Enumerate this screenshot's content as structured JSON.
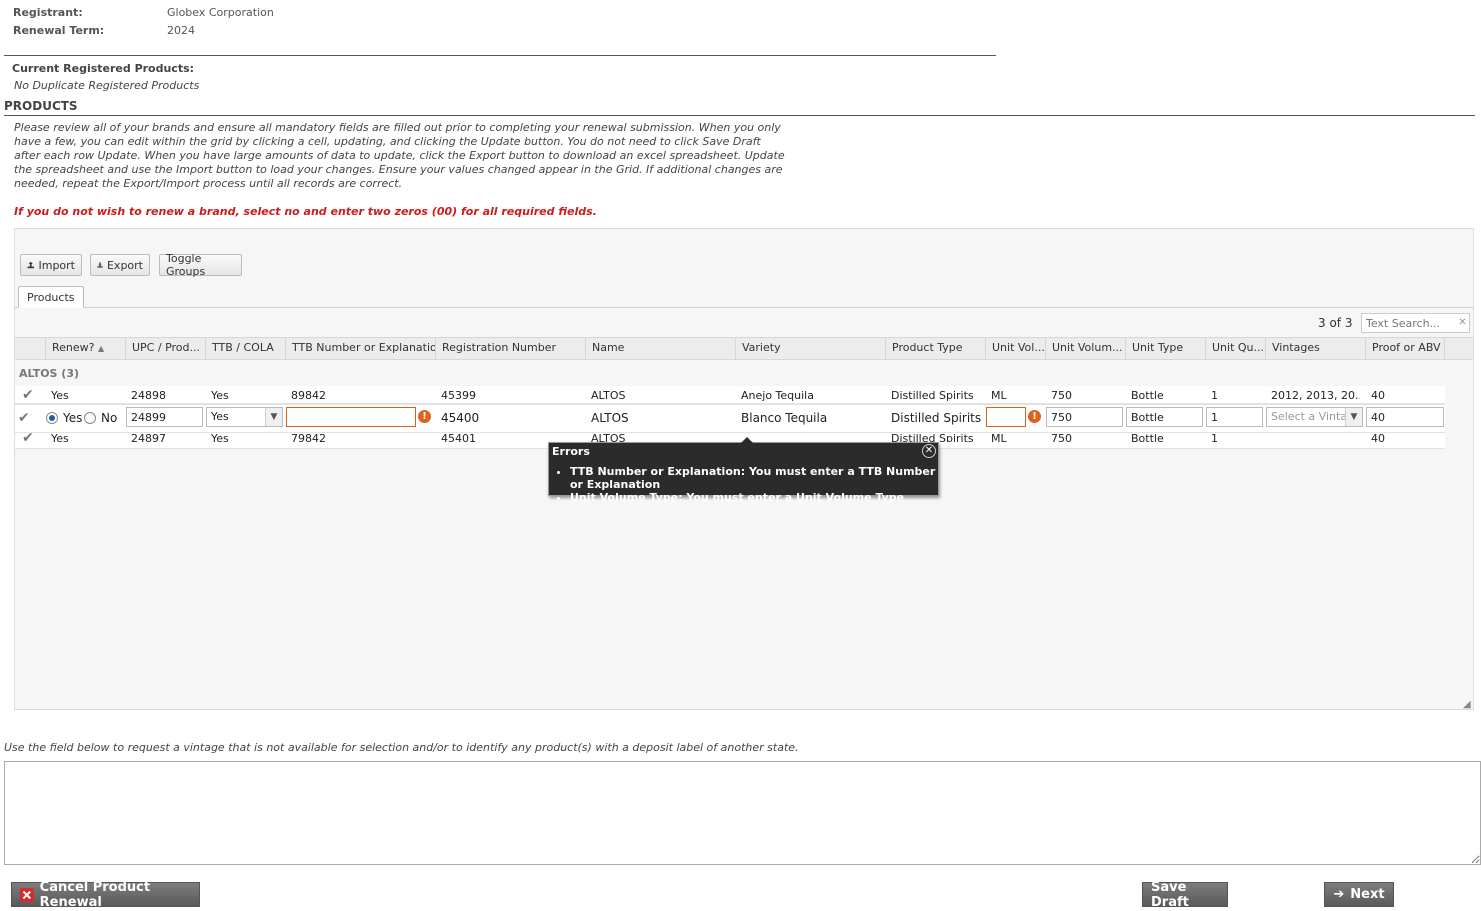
{
  "registration": {
    "registrant_label": "Registrant:",
    "registrant_value": "Globex Corporation",
    "term_label": "Renewal Term:",
    "term_value": "2024"
  },
  "current": {
    "label": "Current Registered Products:",
    "note": "No Duplicate Registered Products"
  },
  "products_section": {
    "title": "PRODUCTS",
    "instructions": "Please review all of your brands and ensure all mandatory fields are filled out prior to completing your renewal submission. When you only have a few, you can edit within the grid by clicking a cell, updating, and clicking the Update button. You do not need to click Save Draft after each row Update. When you have large amounts of data to update, click the Export button to download an excel spreadsheet. Update the spreadsheet and use the Import button to load your changes. Ensure your values changed appear in the Grid. If additional changes are needed, repeat the Export/Import process until all records are correct.",
    "warning": "If you do not wish to renew a brand, select no and enter two zeros (00) for all required fields."
  },
  "toolbar": {
    "import_label": "Import",
    "export_label": "Export",
    "toggle_groups_label": "Toggle Groups"
  },
  "tabs": {
    "products": "Products"
  },
  "pager": {
    "count": "3 of 3",
    "search_placeholder": "Text Search..."
  },
  "columns": {
    "renew": "Renew?",
    "upc": "UPC / Prod...",
    "ttb_cola": "TTB / COLA",
    "ttb_number": "TTB Number or Explanation",
    "reg_number": "Registration Number",
    "name": "Name",
    "variety": "Variety",
    "product_type": "Product Type",
    "unit_vol": "Unit Vol...",
    "unit_volume": "Unit Volum...",
    "unit_type": "Unit Type",
    "unit_qty": "Unit Qu...",
    "vintages": "Vintages",
    "proof": "Proof or ABV"
  },
  "group": {
    "label": "ALTOS (3)"
  },
  "rows": [
    {
      "renew": "Yes",
      "upc": "24898",
      "ttb_cola": "Yes",
      "ttb_number": "89842",
      "reg_number": "45399",
      "name": "ALTOS",
      "variety": "Anejo Tequila",
      "product_type": "Distilled Spirits",
      "unit_vol": "ML",
      "unit_volume": "750",
      "unit_type": "Bottle",
      "unit_qty": "1",
      "vintages": "2012, 2013, 20...",
      "proof": "40"
    },
    {
      "upc": "24899",
      "ttb_cola": "Yes",
      "ttb_number": "",
      "reg_number": "45400",
      "name": "ALTOS",
      "variety": "Blanco Tequila",
      "product_type": "Distilled Spirits",
      "unit_vol": "",
      "unit_volume": "750",
      "unit_type": "Bottle",
      "unit_qty": "1",
      "vintages_placeholder": "Select a Vintage",
      "proof": "40",
      "radio_yes": "Yes",
      "radio_no": "No"
    },
    {
      "renew": "Yes",
      "upc": "24897",
      "ttb_cola": "Yes",
      "ttb_number": "79842",
      "reg_number": "45401",
      "name": "ALTOS",
      "product_type": "Distilled Spirits",
      "unit_vol": "ML",
      "unit_volume": "750",
      "unit_type": "Bottle",
      "unit_qty": "1",
      "proof": "40"
    }
  ],
  "errors": {
    "title": "Errors",
    "items": [
      "TTB Number or Explanation: You must enter a TTB Number or Explanation",
      "Unit Volume Type: You must enter a Unit Volume Type"
    ]
  },
  "vintage_note": "Use the field below to request a vintage that is not available for selection and/or to identify any product(s) with a deposit label of another state.",
  "buttons": {
    "cancel": "Cancel Product Renewal",
    "save_draft": "Save Draft",
    "next": "Next"
  },
  "colors": {
    "warning_red": "#d01b1b",
    "error_orange": "#e0621a",
    "button_gray": "#6b6b6b"
  }
}
